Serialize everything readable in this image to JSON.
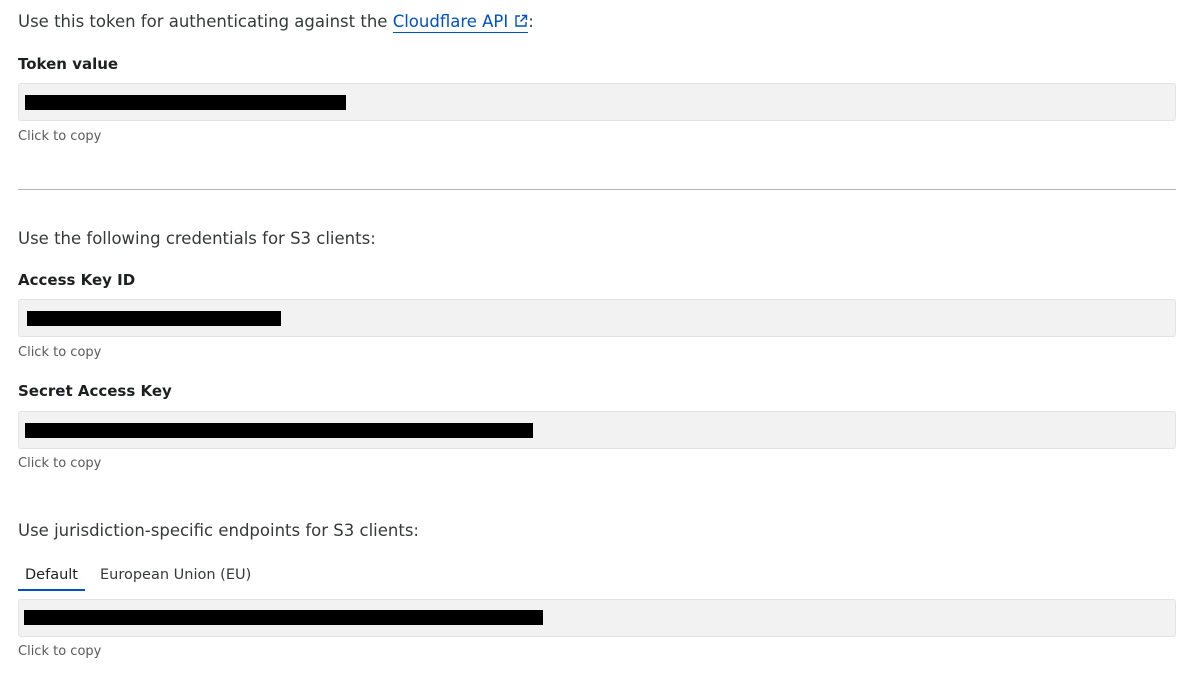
{
  "api_section": {
    "intro_prefix": "Use this token for authenticating against the ",
    "link_text": "Cloudflare API",
    "intro_suffix": ":",
    "token_label": "Token value",
    "copy_hint": "Click to copy"
  },
  "s3_section": {
    "intro": "Use the following credentials for S3 clients:",
    "access_key_label": "Access Key ID",
    "access_key_hint": "Click to copy",
    "secret_key_label": "Secret Access Key",
    "secret_key_hint": "Click to copy"
  },
  "endpoints_section": {
    "intro": "Use jurisdiction-specific endpoints for S3 clients:",
    "tabs": [
      {
        "label": "Default",
        "active": true
      },
      {
        "label": "European Union (EU)",
        "active": false
      }
    ],
    "copy_hint": "Click to copy"
  },
  "colors": {
    "link": "#0051c3",
    "field_bg": "#f2f2f2",
    "redaction": "#000000"
  }
}
